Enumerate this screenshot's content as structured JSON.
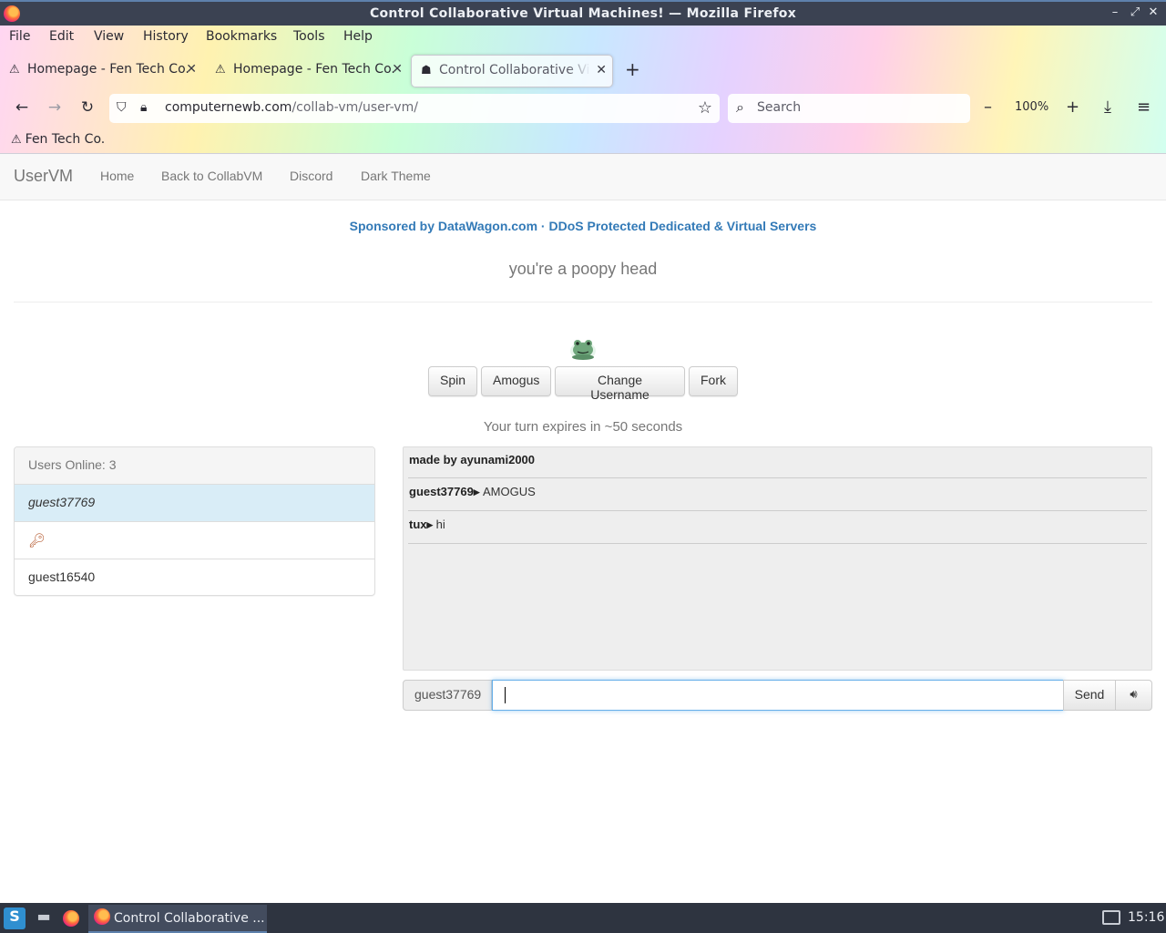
{
  "window": {
    "title": "Control Collaborative Virtual Machines! — Mozilla Firefox"
  },
  "menubar": {
    "items": [
      "File",
      "Edit",
      "View",
      "History",
      "Bookmarks",
      "Tools",
      "Help"
    ]
  },
  "tabs": [
    {
      "label": "Homepage - Fen Tech Co.",
      "icon": "warning-icon",
      "active": false
    },
    {
      "label": "Homepage - Fen Tech Co.",
      "icon": "warning-icon",
      "active": false
    },
    {
      "label": "Control Collaborative Virtual Machines!",
      "icon": "collabvm-icon",
      "active": true
    }
  ],
  "navbar": {
    "url_domain": "computernewb.com",
    "url_path": "/collab-vm/user-vm/",
    "search_placeholder": "Search",
    "zoom": "100%"
  },
  "bookmarks": [
    {
      "label": "Fen Tech Co.",
      "icon": "warning-icon"
    }
  ],
  "site": {
    "brand": "UserVM",
    "nav": [
      "Home",
      "Back to CollabVM",
      "Discord",
      "Dark Theme"
    ],
    "sponsor": "Sponsored by DataWagon.com · DDoS Protected Dedicated & Virtual Servers",
    "motd": "you're a poopy head",
    "buttons": [
      "Spin",
      "Amogus",
      "Change Username",
      "Fork"
    ],
    "turn_status": "Your turn expires in ~50 seconds"
  },
  "users": {
    "header": "Users Online: 3",
    "list": [
      {
        "name": "guest37769",
        "self": true
      },
      {
        "name": "",
        "icon": "key-icon"
      },
      {
        "name": "guest16540"
      }
    ]
  },
  "chat": {
    "messages": [
      {
        "user": "",
        "text": "made by ayunami2000",
        "system": true
      },
      {
        "user": "guest37769",
        "text": "AMOGUS"
      },
      {
        "user": "tux",
        "text": "hi"
      }
    ],
    "username": "guest37769",
    "input_value": "",
    "send_label": "Send",
    "volume_icon": "volume-icon"
  },
  "taskbar": {
    "task_label": "Control Collaborative ...",
    "clock": "15:16"
  },
  "colors": {
    "link": "#337ab7",
    "selected_user": "#d9edf7",
    "taskbar": "#2e3440"
  }
}
